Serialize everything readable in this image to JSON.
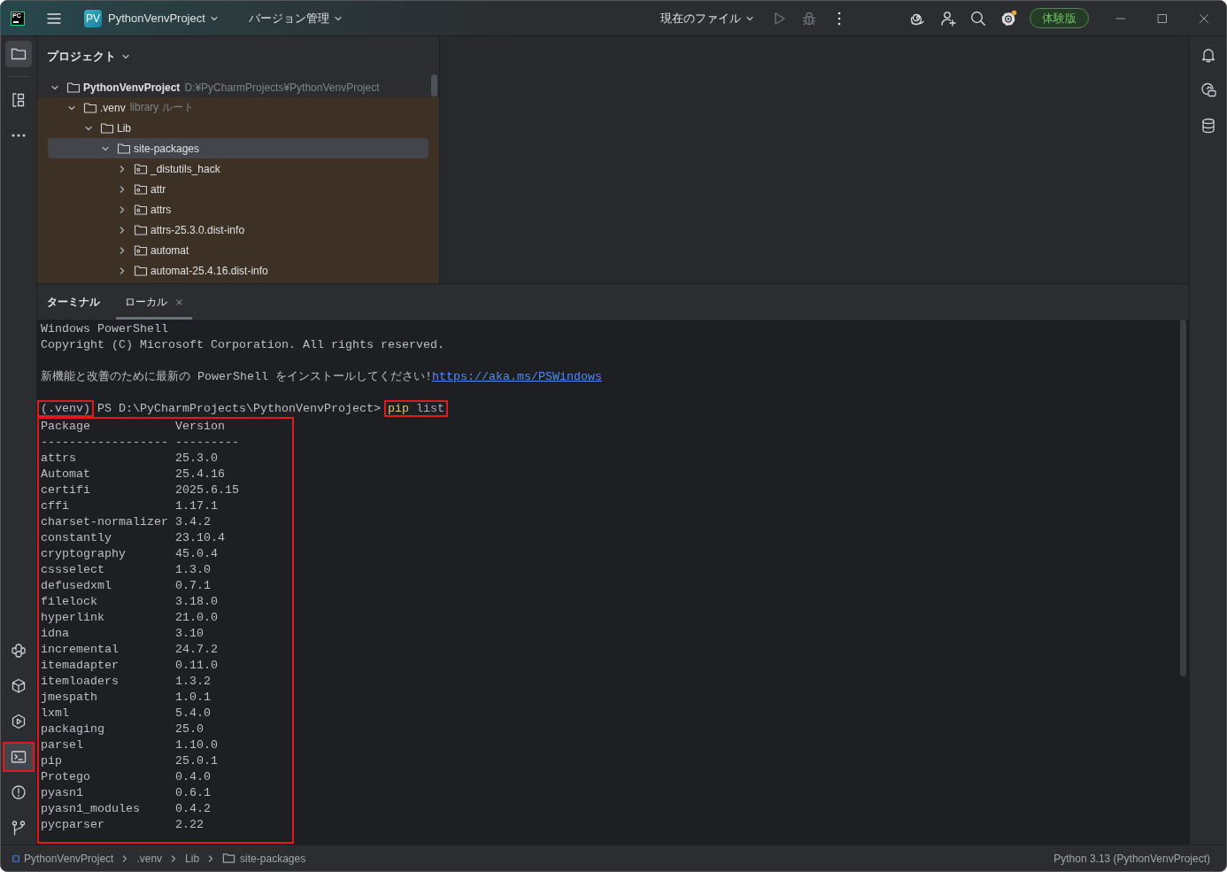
{
  "title_bar": {
    "logo": "PC",
    "project_badge": "PV",
    "project_name": "PythonVenvProject",
    "vcs_menu": "バージョン管理",
    "run_config": "現在のファイル",
    "run_disabled": true,
    "debug_disabled": true,
    "settings_notice": true,
    "trial_badge": "体験版"
  },
  "left_toolbar": {
    "top": [
      {
        "kind": "project",
        "selected": true,
        "highlighted": false
      },
      {
        "kind": "structure",
        "selected": false,
        "highlighted": false
      },
      {
        "kind": "more",
        "selected": false,
        "highlighted": false
      }
    ],
    "bottom": [
      {
        "kind": "python_console",
        "selected": false,
        "highlighted": false
      },
      {
        "kind": "python_packages",
        "selected": false,
        "highlighted": false
      },
      {
        "kind": "services",
        "selected": false,
        "highlighted": false
      },
      {
        "kind": "terminal",
        "selected": true,
        "highlighted": true
      },
      {
        "kind": "problems",
        "selected": false,
        "highlighted": false
      },
      {
        "kind": "git",
        "selected": false,
        "highlighted": false
      }
    ]
  },
  "project_panel": {
    "title": "プロジェクト",
    "tree": [
      {
        "name": "PythonVenvProject",
        "hint": "D:¥PyCharmProjects¥PythonVenvProject",
        "kind": "project",
        "expanded": true,
        "selected": false,
        "children": [
          {
            "name": ".venv",
            "hint": "library ルート",
            "kind": "library",
            "expanded": true,
            "selected": false,
            "children": [
              {
                "name": "Lib",
                "kind": "folder",
                "expanded": true,
                "selected": false,
                "children": [
                  {
                    "name": "site-packages",
                    "kind": "folder",
                    "expanded": true,
                    "selected": true,
                    "children": [
                      {
                        "name": "_distutils_hack",
                        "kind": "package",
                        "expanded": false,
                        "selected": false
                      },
                      {
                        "name": "attr",
                        "kind": "package",
                        "expanded": false,
                        "selected": false
                      },
                      {
                        "name": "attrs",
                        "kind": "package",
                        "expanded": false,
                        "selected": false
                      },
                      {
                        "name": "attrs-25.3.0.dist-info",
                        "kind": "folder",
                        "expanded": false,
                        "selected": false
                      },
                      {
                        "name": "automat",
                        "kind": "package",
                        "expanded": false,
                        "selected": false
                      },
                      {
                        "name": "automat-25.4.16.dist-info",
                        "kind": "folder",
                        "expanded": false,
                        "selected": false
                      }
                    ]
                  }
                ]
              }
            ]
          }
        ]
      }
    ]
  },
  "terminal": {
    "title": "ターミナル",
    "tabs": [
      {
        "label": "ローカル",
        "selected": true
      }
    ],
    "lines": [
      {
        "kind": "text",
        "text": "Windows PowerShell"
      },
      {
        "kind": "text",
        "text": "Copyright (C) Microsoft Corporation. All rights reserved."
      },
      {
        "kind": "blank"
      },
      {
        "kind": "notice",
        "text": "新機能と改善のために最新の PowerShell をインストールしてください!",
        "link": "https://aka.ms/PSWindows"
      },
      {
        "kind": "blank"
      }
    ],
    "prompt": {
      "venv": "(.venv)",
      "venv_highlighted": true,
      "path": "PS D:\\PyCharmProjects\\PythonVenvProject>",
      "command": "pip",
      "args": "list",
      "command_highlighted": true
    },
    "package_list": {
      "highlighted": true,
      "columns": [
        "Package",
        "Version"
      ],
      "separators": [
        "------------------",
        "---------"
      ],
      "rows": [
        [
          "attrs",
          "25.3.0"
        ],
        [
          "Automat",
          "25.4.16"
        ],
        [
          "certifi",
          "2025.6.15"
        ],
        [
          "cffi",
          "1.17.1"
        ],
        [
          "charset-normalizer",
          "3.4.2"
        ],
        [
          "constantly",
          "23.10.4"
        ],
        [
          "cryptography",
          "45.0.4"
        ],
        [
          "cssselect",
          "1.3.0"
        ],
        [
          "defusedxml",
          "0.7.1"
        ],
        [
          "filelock",
          "3.18.0"
        ],
        [
          "hyperlink",
          "21.0.0"
        ],
        [
          "idna",
          "3.10"
        ],
        [
          "incremental",
          "24.7.2"
        ],
        [
          "itemadapter",
          "0.11.0"
        ],
        [
          "itemloaders",
          "1.3.2"
        ],
        [
          "jmespath",
          "1.0.1"
        ],
        [
          "lxml",
          "5.4.0"
        ],
        [
          "packaging",
          "25.0"
        ],
        [
          "parsel",
          "1.10.0"
        ],
        [
          "pip",
          "25.0.1"
        ],
        [
          "Protego",
          "0.4.0"
        ],
        [
          "pyasn1",
          "0.6.1"
        ],
        [
          "pyasn1_modules",
          "0.4.2"
        ],
        [
          "pycparser",
          "2.22"
        ]
      ]
    }
  },
  "status_bar": {
    "breadcrumbs": [
      {
        "label": "PythonVenvProject",
        "kind": "project"
      },
      {
        "label": ".venv",
        "kind": "plain"
      },
      {
        "label": "Lib",
        "kind": "plain"
      },
      {
        "label": "site-packages",
        "kind": "folder"
      }
    ],
    "interpreter": "Python 3.13 (PythonVenvProject)"
  }
}
